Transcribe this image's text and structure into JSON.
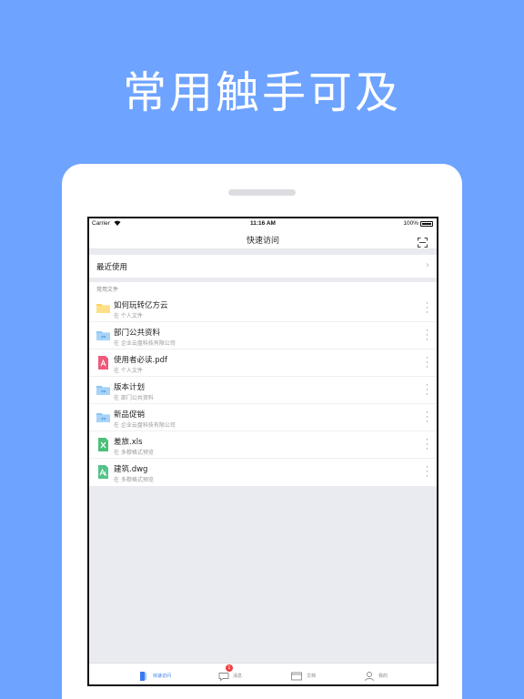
{
  "headline": "常用触手可及",
  "status_bar": {
    "carrier": "Carrier",
    "time": "11:16 AM",
    "battery": "100%"
  },
  "nav": {
    "title": "快速访问",
    "scan_icon": "scan-icon"
  },
  "recent": {
    "label": "最近使用"
  },
  "section": {
    "label": "常用文件"
  },
  "files": [
    {
      "name": "如何玩转亿方云",
      "location": "在 个人文件",
      "icon": "folder-yellow-icon"
    },
    {
      "name": "部门公共资料",
      "location": "在 企业云盘科技有限公司",
      "icon": "shared-folder-icon"
    },
    {
      "name": "使用者必读.pdf",
      "location": "在 个人文件",
      "icon": "pdf-icon"
    },
    {
      "name": "版本计划",
      "location": "在 部门公共资料",
      "icon": "shared-folder-icon"
    },
    {
      "name": "新品促销",
      "location": "在 企业云盘科技有限公司",
      "icon": "shared-folder-icon"
    },
    {
      "name": "差旅.xls",
      "location": "在 多穆格式预览",
      "icon": "excel-icon"
    },
    {
      "name": "建筑.dwg",
      "location": "在 多穆格式预览",
      "icon": "dwg-icon"
    }
  ],
  "tabs": [
    {
      "label": "快速访问",
      "icon": "quick-access-icon",
      "active": true
    },
    {
      "label": "消息",
      "icon": "message-icon",
      "badge": "1"
    },
    {
      "label": "文档",
      "icon": "documents-icon"
    },
    {
      "label": "我的",
      "icon": "profile-icon"
    }
  ],
  "colors": {
    "background": "#6ea3ff",
    "accent": "#3a7bf0",
    "folder_yellow": "#ffd45c",
    "folder_blue": "#8ac4f5",
    "pdf": "#ef5a7a",
    "excel": "#4cc07a",
    "dwg": "#52c48a",
    "badge": "#f04040"
  }
}
